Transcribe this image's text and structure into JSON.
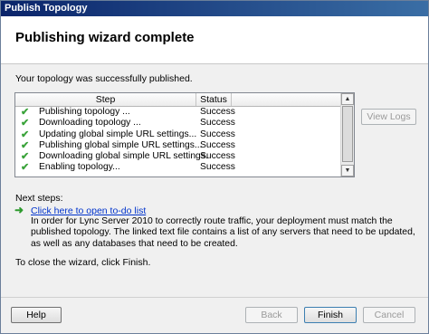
{
  "window": {
    "title": "Publish Topology"
  },
  "header": {
    "title": "Publishing wizard complete"
  },
  "message": "Your topology was successfully published.",
  "grid": {
    "columns": [
      "Step",
      "Status"
    ],
    "rows": [
      {
        "step": "Publishing topology ...",
        "status": "Success"
      },
      {
        "step": "Downloading topology ...",
        "status": "Success"
      },
      {
        "step": "Updating global simple URL settings...",
        "status": "Success"
      },
      {
        "step": "Publishing global simple URL settings...",
        "status": "Success"
      },
      {
        "step": "Downloading global simple URL settings.",
        "status": "Success"
      },
      {
        "step": "Enabling topology...",
        "status": "Success"
      }
    ]
  },
  "view_logs_label": "View Logs",
  "next_steps": {
    "label": "Next steps:",
    "link": "Click here to open to-do list",
    "description": "In order for Lync Server 2010 to correctly route traffic, your deployment must match the published topology. The linked text file contains a list of any servers that need to be updated, as well as any databases that need to be created."
  },
  "close_note": "To close the wizard, click Finish.",
  "footer": {
    "help": "Help",
    "back": "Back",
    "finish": "Finish",
    "cancel": "Cancel"
  }
}
